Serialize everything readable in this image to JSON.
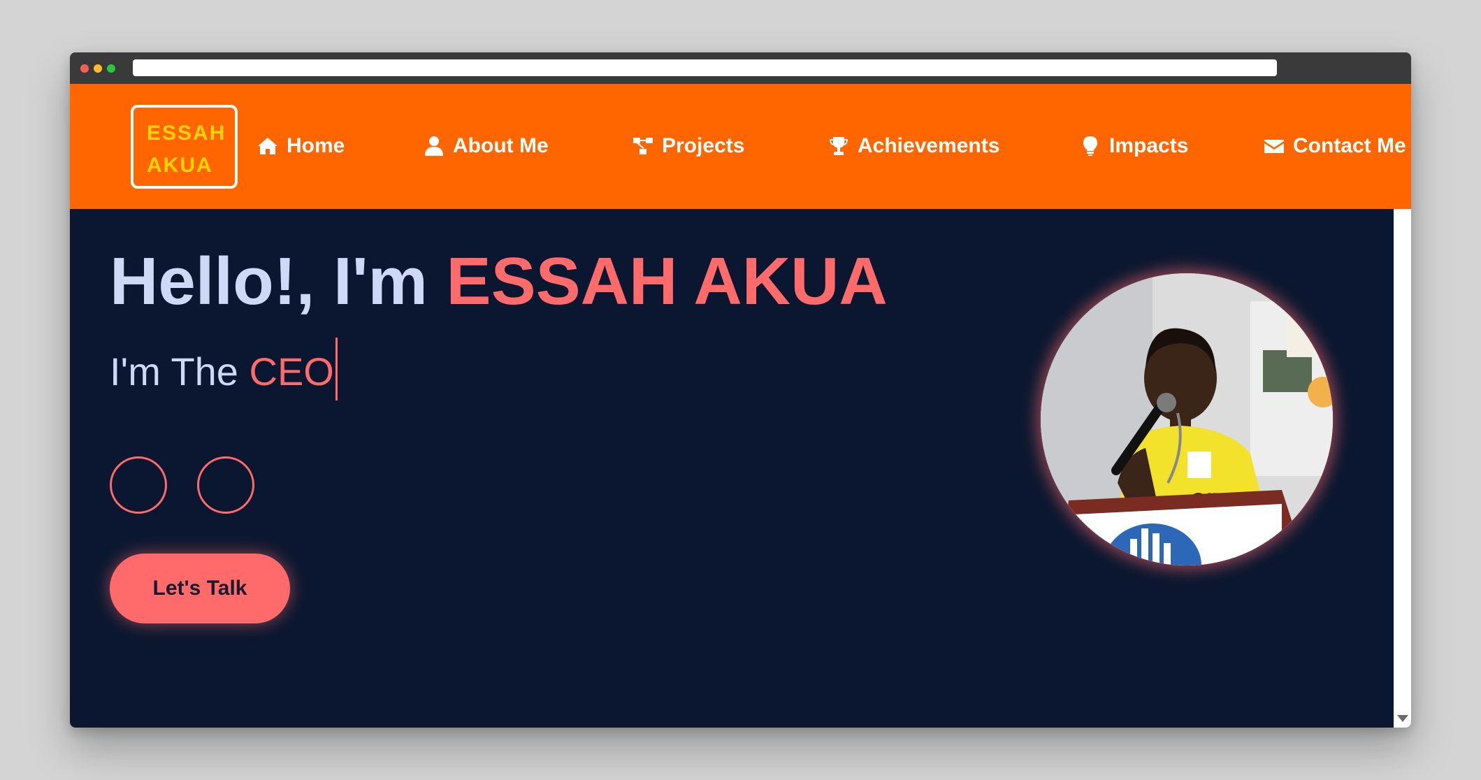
{
  "logo": {
    "line1": "ESSAH",
    "line2": "AKUA"
  },
  "nav": {
    "home": "Home",
    "about": "About Me",
    "projects": "Projects",
    "achievements": "Achievements",
    "impacts": "Impacts",
    "contact": "Contact Me"
  },
  "icons": {
    "home": "home-icon",
    "about": "user-icon",
    "projects": "sitemap-icon",
    "achievements": "trophy-icon",
    "impacts": "lightbulb-icon",
    "contact": "envelope-icon"
  },
  "hero": {
    "greeting": "Hello!, I'm",
    "name": "ESSAH AKUA",
    "role_prefix": "I'm The",
    "role": "CEO"
  },
  "cta": {
    "label": "Let's Talk"
  },
  "colors": {
    "navbar": "#ff6600",
    "background": "#0b1730",
    "accent": "#ff6b6b",
    "logo_text": "#ffd400",
    "text": "#cdd9f7"
  }
}
